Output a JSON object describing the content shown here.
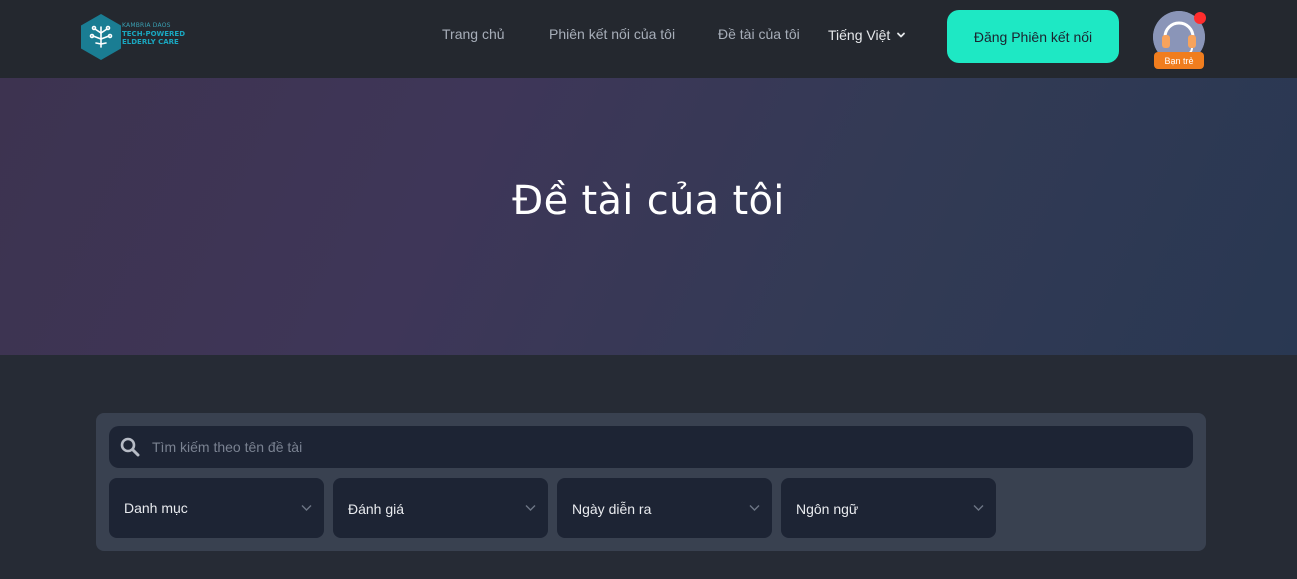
{
  "logo": {
    "line1": "KAMBRIA DAOS",
    "line2": "TECH-POWERED",
    "line3": "ELDERLY CARE"
  },
  "nav": {
    "home": "Trang chủ",
    "sessions": "Phiên kết nối của tôi",
    "topics": "Đề tài của tôi",
    "language": "Tiếng Việt",
    "cta": "Đăng Phiên kết nối"
  },
  "user": {
    "role_badge": "Bạn trẻ"
  },
  "hero": {
    "title": "Đề tài của tôi"
  },
  "search": {
    "placeholder": "Tìm kiếm theo tên đề tài"
  },
  "filters": [
    {
      "label": "Danh mục"
    },
    {
      "label": "Đánh giá"
    },
    {
      "label": "Ngày diễn ra"
    },
    {
      "label": "Ngôn ngữ"
    }
  ],
  "colors": {
    "header_bg": "#24282f",
    "accent": "#1ee8c4",
    "badge": "#f07d1e",
    "notification": "#ff2d2d",
    "panel_bg": "#394150",
    "field_bg": "#1d2434"
  }
}
